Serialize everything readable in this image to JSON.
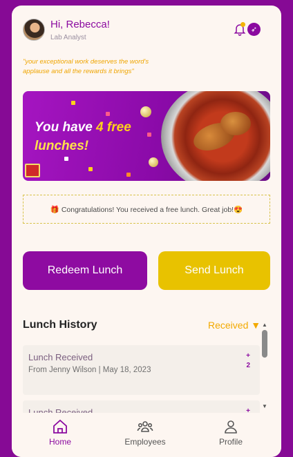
{
  "header": {
    "greeting": "Hi, Rebecca!",
    "role": "Lab Analyst",
    "quote": "\"your exceptional work deserves the word's applause and all the rewards it brings\""
  },
  "banner": {
    "line1_prefix": "You have ",
    "line1_number": "4",
    "line1_suffix": " free",
    "line2": "lunches!"
  },
  "notice": {
    "text": "🎁 Congratulations! You received a free lunch. Great job!😍"
  },
  "actions": {
    "redeem_label": "Redeem Lunch",
    "send_label": "Send Lunch"
  },
  "history": {
    "title": "Lunch History",
    "filter_label": "Received ▼",
    "items": [
      {
        "title": "Lunch Received",
        "subtitle": "From Jenny Wilson | May 18, 2023",
        "plus": "+",
        "count": "2"
      },
      {
        "title": "Lunch Received",
        "subtitle": "",
        "plus": "+",
        "count": ""
      }
    ]
  },
  "nav": {
    "items": [
      {
        "label": "Home",
        "icon": "home-icon"
      },
      {
        "label": "Employees",
        "icon": "employees-icon"
      },
      {
        "label": "Profile",
        "icon": "profile-icon"
      }
    ]
  },
  "colors": {
    "primary": "#8b0aa0",
    "accent": "#e8c200",
    "filter": "#f2a900",
    "background": "#fdf6f1"
  }
}
